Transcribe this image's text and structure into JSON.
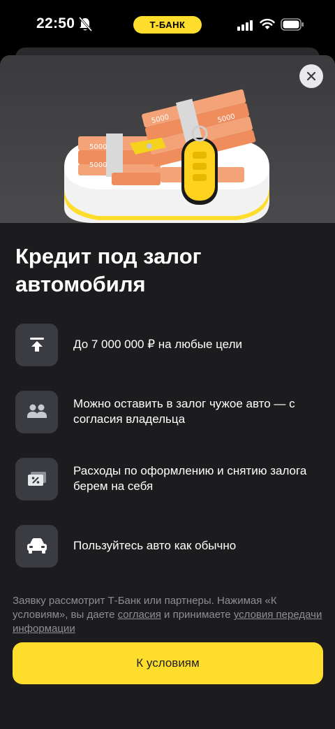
{
  "status_bar": {
    "time": "22:50",
    "bank_label": "Т-БАНК",
    "icons": [
      "bell-slash-icon",
      "cellular-signal-icon",
      "wifi-icon",
      "battery-icon"
    ]
  },
  "modal": {
    "close_icon": "close-icon",
    "hero_image": "car-key-on-money-stacks-illustration",
    "title": "Кредит под залог автомобиля",
    "features": [
      {
        "icon": "upload-arrow-icon",
        "text": "До 7 000 000 ₽ на любые цели"
      },
      {
        "icon": "people-icon",
        "text": "Можно оставить в залог чужое авто — с согласия владельца"
      },
      {
        "icon": "discount-ticket-icon",
        "text": "Расходы по оформлению и снятию залога берем на себя"
      },
      {
        "icon": "car-icon",
        "text": "Пользуйтесь авто как обычно"
      }
    ],
    "legal": {
      "text_before": "Заявку рассмотрит Т-Банк или партнеры. Нажимая «К условиям», вы даете ",
      "link_consent": "согласия",
      "text_middle": " и принимаете ",
      "link_terms": "условия передачи информации"
    },
    "cta_label": "К условиям"
  },
  "colors": {
    "accent_yellow": "#ffdd2d",
    "sheet_background": "#1c1c1e",
    "icon_tile": "#3a3c42",
    "muted_text": "#8e8e93"
  }
}
